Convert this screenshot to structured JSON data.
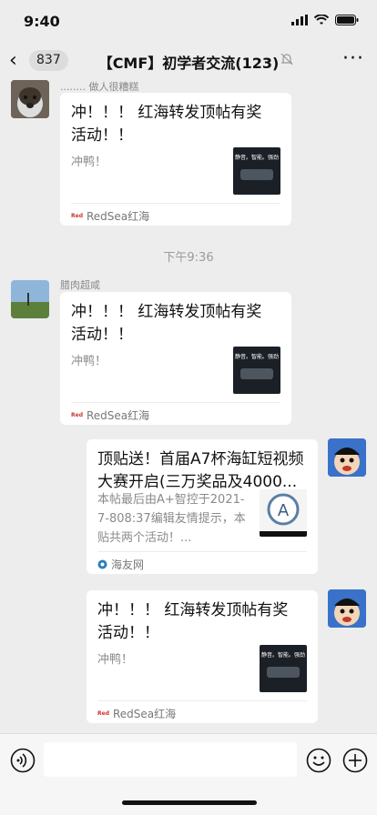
{
  "status": {
    "time": "9:40"
  },
  "nav": {
    "back_count": "837",
    "title": "【CMF】初学者交流(123)"
  },
  "messages": [
    {
      "sender": "........ 做人很糟糕",
      "title": "冲！！！ 红海转发顶帖有奖活动！！",
      "desc": "冲鸭！",
      "source": "RedSea红海",
      "thumb_text": "静音。智能。强劲"
    },
    {
      "sender": "腊肉超咸",
      "title": "冲！！！ 红海转发顶帖有奖活动！！",
      "desc": "冲鸭！",
      "source": "RedSea红海",
      "thumb_text": "静音。智能。强劲"
    },
    {
      "sender": "",
      "title": "顶贴送！首届A7杯海缸短视频大赛开启(三万奖品及4000...",
      "desc": "本帖最后由A+智控于2021-7-808:37编辑友情提示，本贴共两个活动！...",
      "source": "海友网",
      "thumb_text": ""
    },
    {
      "sender": "",
      "title": "冲！！！ 红海转发顶帖有奖活动！！",
      "desc": "冲鸭！",
      "source": "RedSea红海",
      "thumb_text": "静音。智能。强劲"
    }
  ],
  "timestamp": "下午9:36",
  "colors": {
    "background": "#ededed",
    "card": "#ffffff",
    "meta": "#8a8a8a",
    "accent": "#07c160"
  }
}
